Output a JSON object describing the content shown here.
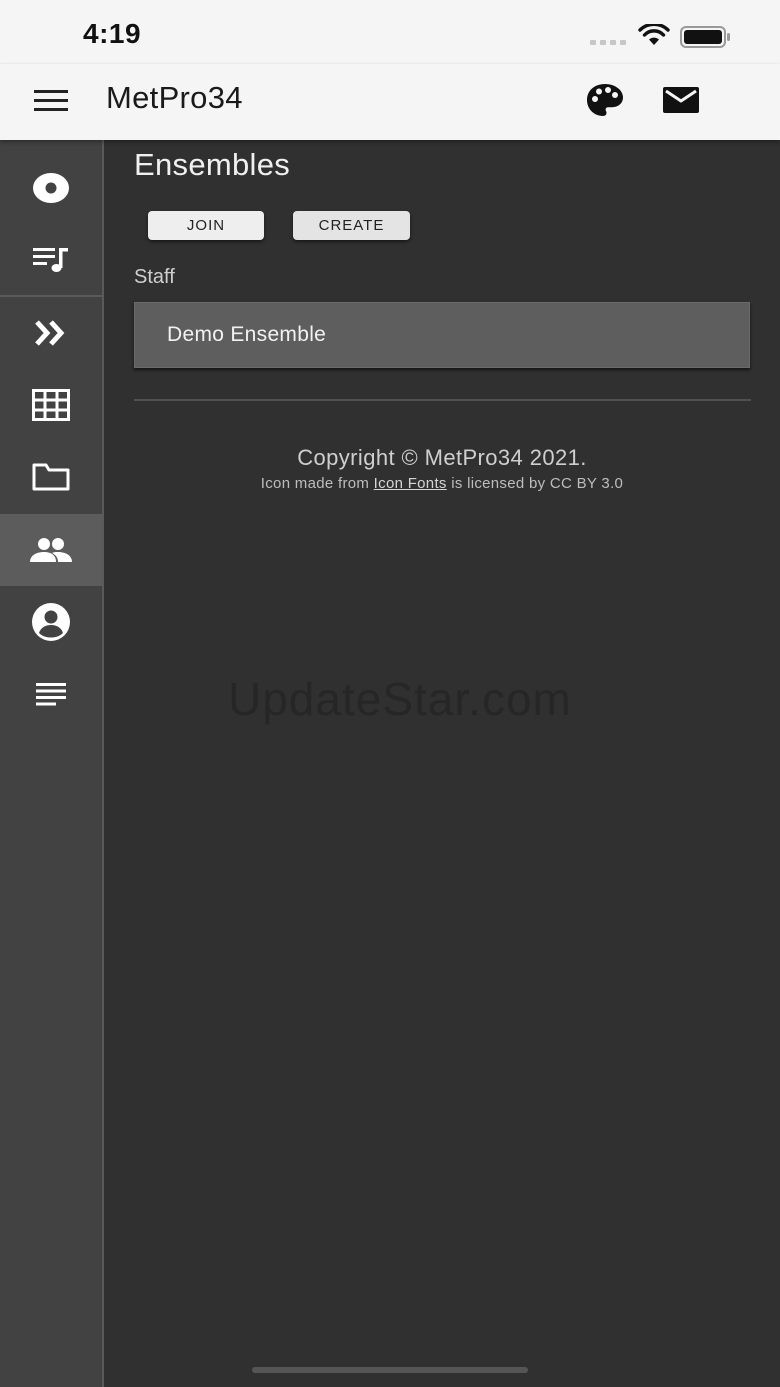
{
  "status_bar": {
    "time": "4:19"
  },
  "app_bar": {
    "title": "MetPro34"
  },
  "sidebar": {
    "items": [
      {
        "icon": "disc-icon"
      },
      {
        "icon": "playlist-icon"
      },
      {
        "icon": "double-chevron-icon"
      },
      {
        "icon": "grid-icon"
      },
      {
        "icon": "folder-icon"
      },
      {
        "icon": "people-icon",
        "active": true
      },
      {
        "icon": "account-circle-icon"
      },
      {
        "icon": "notes-icon"
      }
    ]
  },
  "main": {
    "title": "Ensembles",
    "join_label": "JOIN",
    "create_label": "CREATE",
    "section_label": "Staff",
    "ensembles": [
      "Demo Ensemble"
    ]
  },
  "footer": {
    "copyright": "Copyright © MetPro34 2021.",
    "credit_prefix": "Icon made from",
    "credit_link": "Icon Fonts",
    "credit_suffix": "is licensed by CC BY 3.0"
  },
  "watermark": "UpdateStar.com",
  "colors": {
    "background": "#303030",
    "sidebar": "#424242",
    "active_item": "#5c5c5c",
    "appbar": "#f5f5f5"
  }
}
